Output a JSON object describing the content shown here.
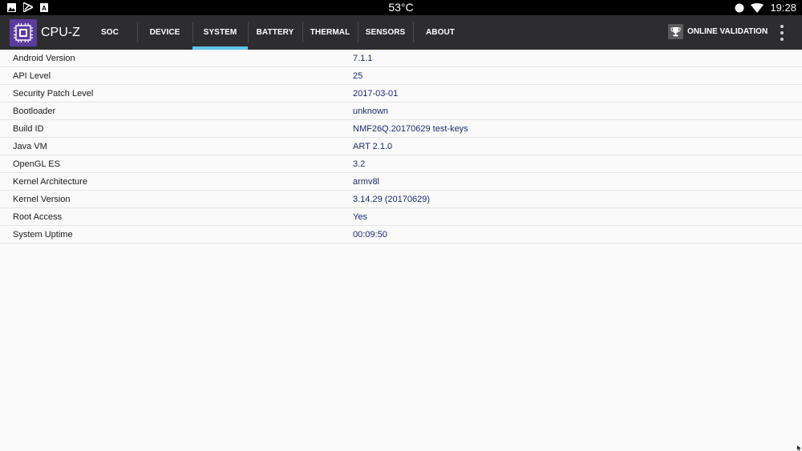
{
  "status_bar": {
    "temperature": "53°C",
    "time": "19:28",
    "left_icons": [
      "image-icon",
      "cast-icon",
      "apk-icon"
    ],
    "right_icons": [
      "record-icon",
      "wifi-icon"
    ]
  },
  "app": {
    "title": "CPU-Z",
    "brand_color": "#5b3c9e",
    "accent_color": "#5ec4ea"
  },
  "tabs": [
    {
      "label": "SOC",
      "active": false
    },
    {
      "label": "DEVICE",
      "active": false
    },
    {
      "label": "SYSTEM",
      "active": true
    },
    {
      "label": "BATTERY",
      "active": false
    },
    {
      "label": "THERMAL",
      "active": false
    },
    {
      "label": "SENSORS",
      "active": false
    },
    {
      "label": "ABOUT",
      "active": false
    }
  ],
  "toolbar": {
    "validation_label": "ONLINE VALIDATION"
  },
  "system_info": [
    {
      "key": "Android Version",
      "value": "7.1.1"
    },
    {
      "key": "API Level",
      "value": "25"
    },
    {
      "key": "Security Patch Level",
      "value": "2017-03-01"
    },
    {
      "key": "Bootloader",
      "value": "unknown"
    },
    {
      "key": "Build ID",
      "value": "NMF26Q.20170629 test-keys"
    },
    {
      "key": "Java VM",
      "value": "ART 2.1.0"
    },
    {
      "key": "OpenGL ES",
      "value": "3.2"
    },
    {
      "key": "Kernel Architecture",
      "value": "armv8l"
    },
    {
      "key": "Kernel Version",
      "value": "3.14.29 (20170629)"
    },
    {
      "key": "Root Access",
      "value": "Yes"
    },
    {
      "key": "System Uptime",
      "value": "00:09:50"
    }
  ]
}
